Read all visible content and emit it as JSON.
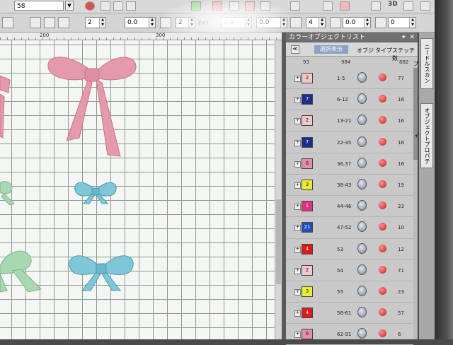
{
  "toolbar": {
    "design_number": "58",
    "stitch_count": "4",
    "value_a": "2",
    "value_b": "0.0",
    "value_c": "2",
    "value_d": "0.0",
    "value_e": "0.0",
    "value_f": "0.0",
    "value_g": "4",
    "value_h": "0.0",
    "value_i": "0",
    "size_label": "3D",
    "label_pxy": "PXY"
  },
  "ruler": {
    "marks": [
      "200",
      "300"
    ]
  },
  "panel": {
    "title": "カラーオブジェクトリスト",
    "select_display": "選択表示",
    "col_object": "オブジ",
    "col_type": "タイプ",
    "col_stitch": "ステッチ数",
    "num_left": "93",
    "num_mid": "984",
    "num_right": "882",
    "rows": [
      {
        "color": "2",
        "swatch": "#f2c7c9",
        "range": "1-5",
        "val": "77"
      },
      {
        "color": "7",
        "swatch": "#1b2f8f",
        "range": "6-12",
        "val": "16"
      },
      {
        "color": "2",
        "swatch": "#f2c7c9",
        "range": "13-21",
        "val": "16"
      },
      {
        "color": "7",
        "swatch": "#1b2f8f",
        "range": "22-35",
        "val": "16"
      },
      {
        "color": "6",
        "swatch": "#e98ab0",
        "range": "36,37",
        "val": "16"
      },
      {
        "color": "3",
        "swatch": "#e9ef2c",
        "range": "38-43",
        "val": "19"
      },
      {
        "color": "1",
        "swatch": "#e1327a",
        "range": "44-46",
        "val": "23"
      },
      {
        "color": "21",
        "swatch": "#1e4fbf",
        "range": "47-52",
        "val": "10"
      },
      {
        "color": "4",
        "swatch": "#e11919",
        "range": "53",
        "val": "12"
      },
      {
        "color": "2",
        "swatch": "#f2c7c9",
        "range": "54",
        "val": "71"
      },
      {
        "color": "3",
        "swatch": "#e9ef2c",
        "range": "55",
        "val": "23"
      },
      {
        "color": "4",
        "swatch": "#e11919",
        "range": "56-61",
        "val": "57"
      },
      {
        "color": "6",
        "swatch": "#e98ab0",
        "range": "62-91",
        "val": "6"
      }
    ]
  },
  "side_tabs": {
    "tab1": "ニードルスカンプ",
    "tab2": "オブジェクトプロパティ"
  },
  "colors": {
    "pink_bow": "#e59aab",
    "blue_bow": "#7ec7d9",
    "green_bow": "#a8d8b0",
    "canvas": "#f3f6f3",
    "grid": "#8e9a8e"
  }
}
